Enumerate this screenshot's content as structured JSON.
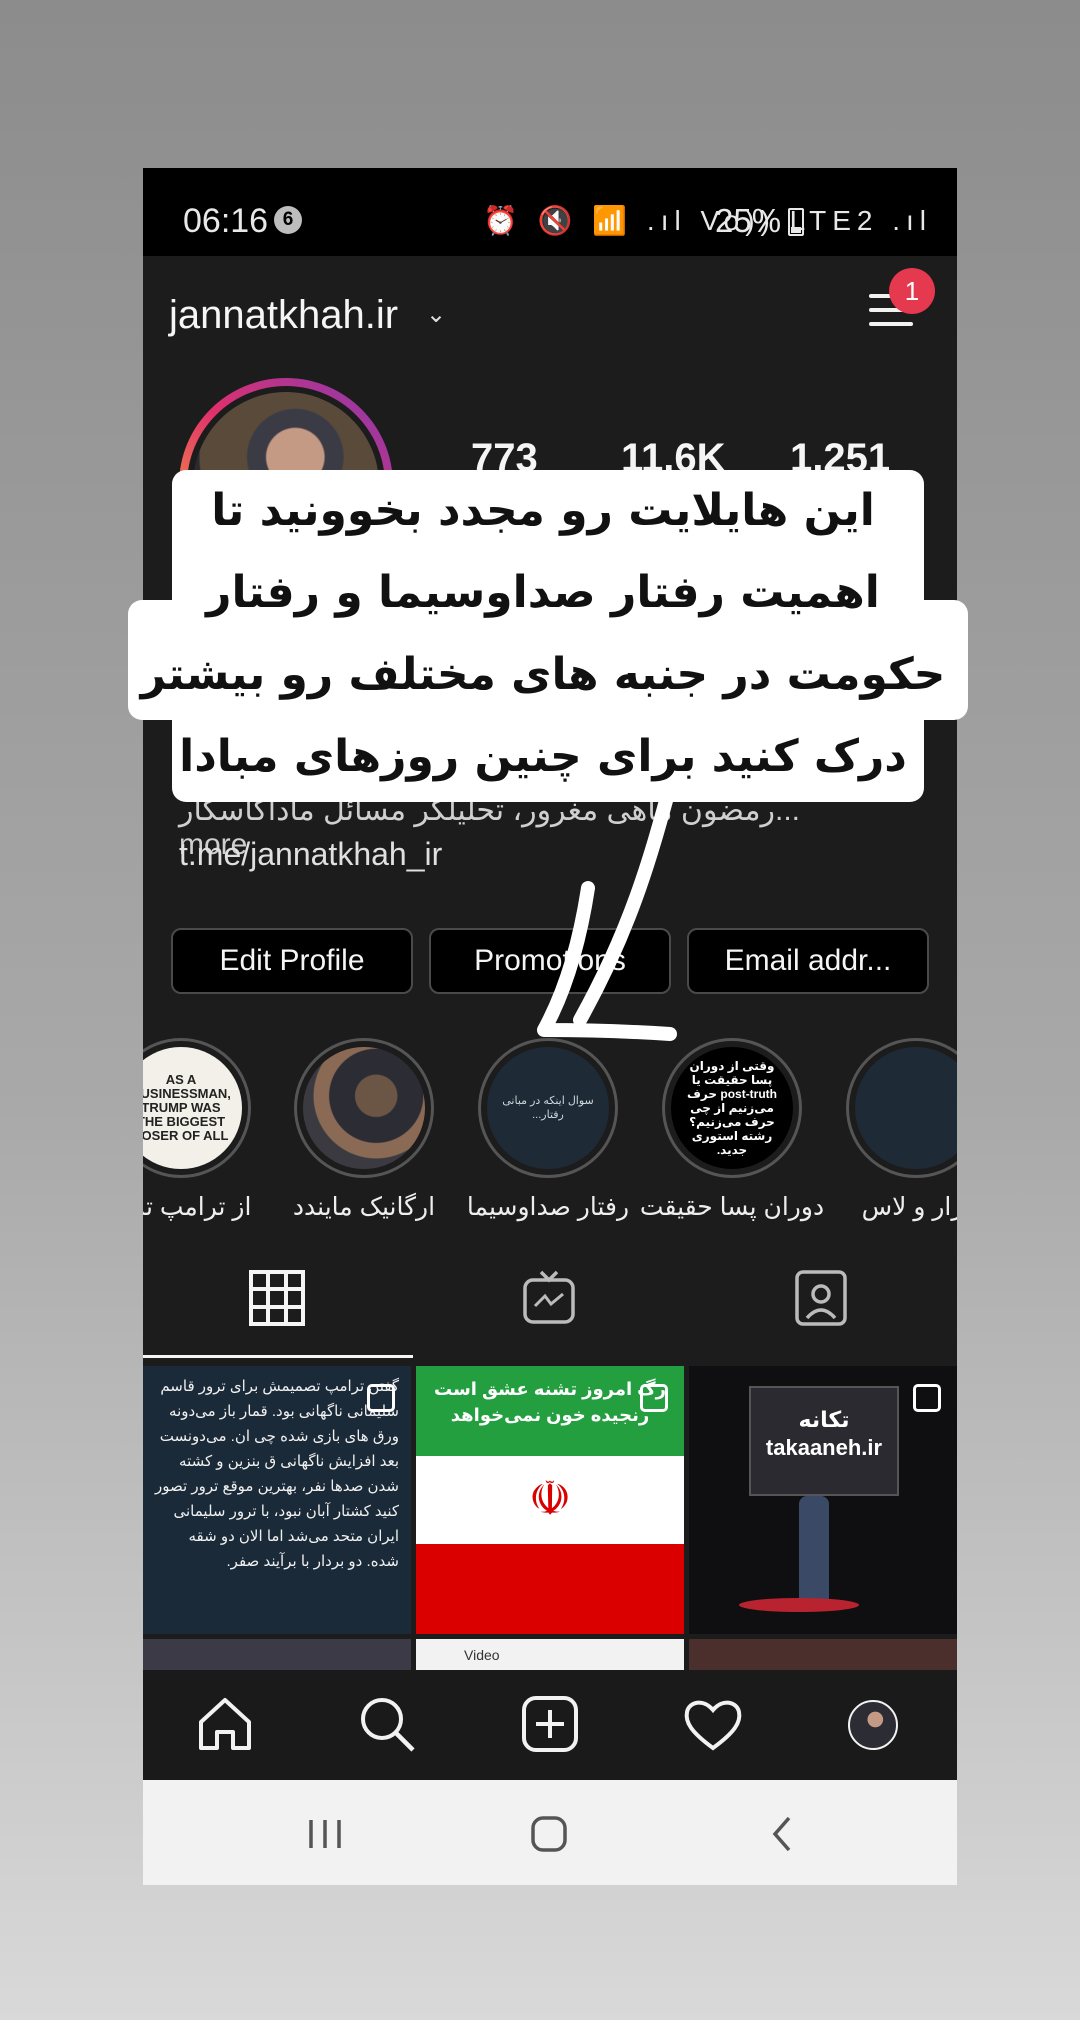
{
  "status_bar": {
    "time": "06:16",
    "notification_count": "6",
    "icons": "⏰ 🔇 📶 .ıl Vo)) LTE2 .ıl",
    "battery_percent": "25%"
  },
  "header": {
    "username": "jannatkhah.ir",
    "chevron": "⌄",
    "menu_badge": "1"
  },
  "profile": {
    "stats": [
      "773",
      "11.6K",
      "1,251"
    ],
    "bio_line": "...رمضون ماهی مغرور، تحلیلگر مسائل ماداکاسکار more",
    "link": "t.me/jannatkhah_ir"
  },
  "buttons": {
    "edit_profile": "Edit Profile",
    "promotions": "Promotions",
    "email": "Email addr..."
  },
  "highlights": [
    {
      "label": "از ترامپ تا ...",
      "thumb_text": "AS A BUSINESSMAN, TRUMP WAS THE BIGGEST LOSER OF ALL"
    },
    {
      "label": "ارگانیک مایندد",
      "thumb_text": ""
    },
    {
      "label": "رفتار صداوسیما",
      "thumb_text": "سوال اینکه در مبانی رفتار..."
    },
    {
      "label": "دوران پسا حقیقت",
      "thumb_text": "وقتی از دوران پسا حقیقت یا post-truth حرف می‌زنیم از چی حرف می‌زنیم؟ رشته استوری جدید."
    },
    {
      "label": "آزار و لاس",
      "thumb_text": ""
    }
  ],
  "grid": {
    "post1_text": "گفتن ترامپ تصمیمش برای ترور قاسم سلیمانی ناگهانی بود. قمار باز می‌دونه ورق های بازی شده چی ان. می‌دونست بعد افزایش ناگهانی ق بنزین و کشته شدن صدها نفر، بهترین موقع ترور تصور کنید کشتار آبان نبود، با ترور سلیمانی ایران متحد می‌شد اما الان دو شقه شده. دو بردار با برآیند صفر.",
    "post2_text": "رگ امروز تشنه عشق است رنجیده خون نمی‌خواهد",
    "post3_text": "تکانه takaaneh.ir",
    "post5_text": "Video"
  },
  "overlay": {
    "line1": "این هایلایت رو مجدد بخوونید تا",
    "line2": "اهمیت رفتار صداوسیما و رفتار",
    "line3": "حکومت در جنبه های مختلف رو بیشتر",
    "line4": "درک کنید برای چنین روزهای مبادا"
  },
  "colors": {
    "background": "#1c1c1c",
    "badge": "#e53950",
    "story_ring_start": "#f7b733",
    "story_ring_end": "#833ab4"
  }
}
